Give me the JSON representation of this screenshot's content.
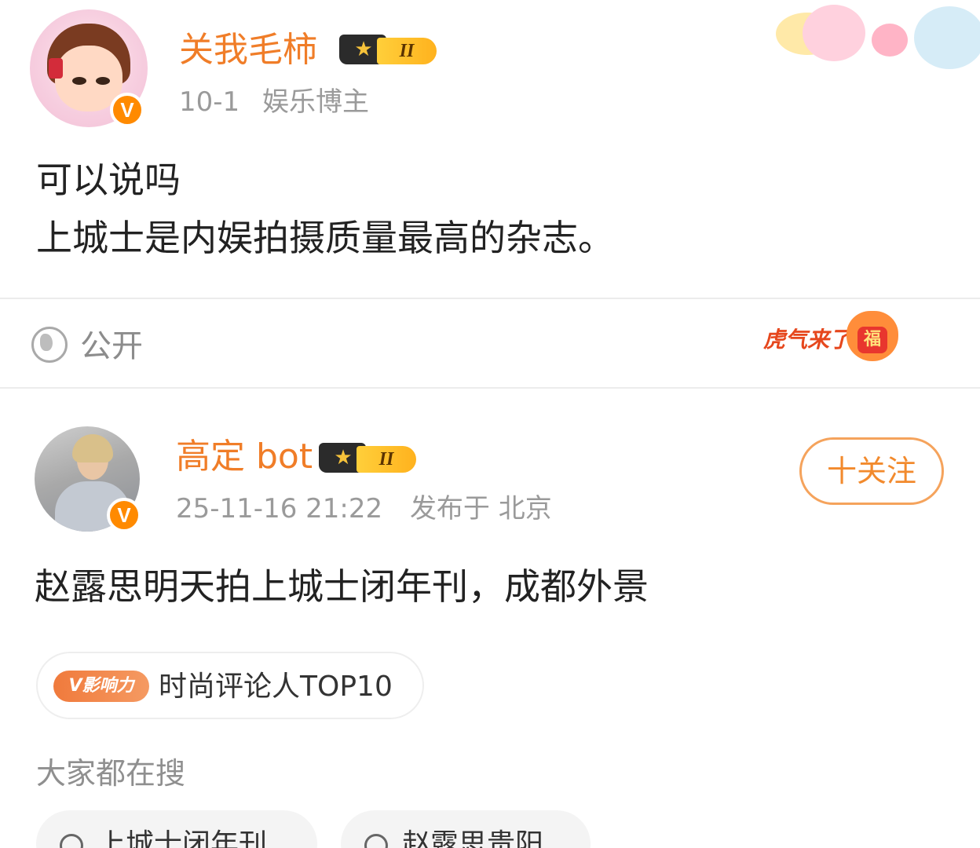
{
  "post1": {
    "username": "关我毛柿",
    "level_badge": "II",
    "verified_badge": "V",
    "date": "10-1",
    "tag": "娱乐博主",
    "content_lines": [
      "可以说吗",
      "上城士是内娱拍摄质量最高的杂志。"
    ]
  },
  "visibility": {
    "label": "公开",
    "icon": "globe-icon"
  },
  "sticker": {
    "text": "虎气来了",
    "paw_text": "福"
  },
  "post2": {
    "username": "高定 bot",
    "level_badge": "II",
    "verified_badge": "V",
    "timestamp": "25-11-16 21:22",
    "location": "发布于 北京",
    "follow_label": "十关注",
    "content": "赵露思明天拍上城士闭年刊，成都外景"
  },
  "influence": {
    "badge": "V影响力",
    "text": "时尚评论人TOP10"
  },
  "search": {
    "title": "大家都在搜",
    "chips": [
      {
        "label": "上城士闭年刊"
      },
      {
        "label": "赵露思贵阳"
      }
    ]
  },
  "colors": {
    "username": "#f07d28",
    "accent": "#ff8a00",
    "meta": "#9a9a9a"
  }
}
